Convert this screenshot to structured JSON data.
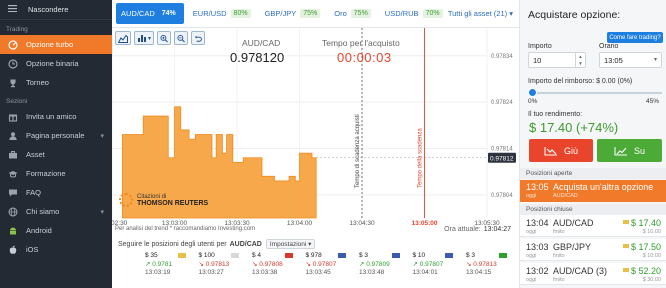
{
  "sidebar": {
    "hide_label": "Nascondere",
    "section_trading": "Trading",
    "section_sections": "Sezioni",
    "items_trading": [
      {
        "label": "Opzione turbo",
        "icon": "turbo-icon"
      },
      {
        "label": "Opzione binaria",
        "icon": "binary-icon"
      },
      {
        "label": "Torneo",
        "icon": "trophy-icon"
      }
    ],
    "items_sections": [
      {
        "label": "Invita un amico",
        "icon": "gift-icon"
      },
      {
        "label": "Pagina personale",
        "icon": "user-icon"
      },
      {
        "label": "Asset",
        "icon": "briefcase-icon"
      },
      {
        "label": "Formazione",
        "icon": "graduation-icon"
      },
      {
        "label": "FAQ",
        "icon": "chat-icon"
      },
      {
        "label": "Chi siamo",
        "icon": "globe-icon"
      },
      {
        "label": "Android",
        "icon": "android-icon"
      },
      {
        "label": "iOS",
        "icon": "apple-icon"
      }
    ]
  },
  "tabs": [
    {
      "pair": "AUD/CAD",
      "pct": "74%"
    },
    {
      "pair": "EUR/USD",
      "pct": "80%"
    },
    {
      "pair": "GBP/JPY",
      "pct": "75%"
    },
    {
      "pair": "Oro",
      "pct": "75%"
    },
    {
      "pair": "USD/RUB",
      "pct": "70%"
    }
  ],
  "all_assets": "Tutti gli asset (21)",
  "chart_header": {
    "pair": "AUD/CAD",
    "price": "0.978120",
    "time_label": "Tempo per l'acquisto",
    "time_value": "00:00:03"
  },
  "chart_data": {
    "type": "area",
    "y_ticks": [
      "0.97834",
      "0.97824",
      "0.97814",
      "0.97804"
    ],
    "y_current": "0.97812",
    "x_ticks": [
      "13:02:30",
      "13:03:00",
      "13:03:30",
      "13:04:00",
      "13:04:30",
      "13:05:00",
      "13:05:30"
    ],
    "x_highlight": "13:05:00",
    "vline_purchase": "Tempo di scadenza acquisti",
    "vline_expiry": "Tempo della scadenza",
    "series": {
      "x": [
        "13:02:35",
        "13:02:40",
        "13:02:45",
        "13:02:50",
        "13:02:53",
        "13:02:57",
        "13:03:00",
        "13:03:03",
        "13:03:07",
        "13:03:10",
        "13:03:14",
        "13:03:18",
        "13:03:20",
        "13:03:23",
        "13:03:25",
        "13:03:28",
        "13:03:30",
        "13:03:33",
        "13:03:35",
        "13:03:38",
        "13:03:42",
        "13:03:45",
        "13:03:48",
        "13:03:52",
        "13:03:55",
        "13:03:58",
        "13:04:00",
        "13:04:03",
        "13:04:06",
        "13:04:08"
      ],
      "y": [
        0.97817,
        0.97817,
        0.97821,
        0.97821,
        0.97821,
        0.97812,
        0.97823,
        0.97818,
        0.97816,
        0.97817,
        0.97817,
        0.97812,
        0.97817,
        0.97813,
        0.97817,
        0.97811,
        0.97811,
        0.97812,
        0.97812,
        0.97812,
        0.97808,
        0.97808,
        0.97807,
        0.97807,
        0.97808,
        0.97807,
        0.97813,
        0.97813,
        0.97812,
        0.97812
      ]
    }
  },
  "thomson": {
    "line1": "Citazioni di",
    "line2": "THOMSON REUTERS"
  },
  "info": {
    "source": "Per analisi del trend * raccomandiamo Investing.com",
    "now_label": "Ora attuale:",
    "now_value": "13:04:27"
  },
  "follow": {
    "text": "Seguire le posizioni degli utenti per",
    "pair": "AUD/CAD",
    "settings": "Impostazioni"
  },
  "trades": [
    {
      "amt": "$ 35",
      "dir": "up",
      "price": "0.9781",
      "time": "13:03:19",
      "flag": "#e5c04a"
    },
    {
      "amt": "$ 100",
      "dir": "dn",
      "price": "0.97813",
      "time": "13:03:27",
      "flag": "#d8d8d8"
    },
    {
      "amt": "$ 4",
      "dir": "dn",
      "price": "0.97808",
      "time": "13:03:38",
      "flag": "#d9382b"
    },
    {
      "amt": "$ 978",
      "dir": "dn",
      "price": "0.97807",
      "time": "13:03:45",
      "flag": "#3b5bb0"
    },
    {
      "amt": "$ 3",
      "dir": "up",
      "price": "0.97809",
      "time": "13:03:48",
      "flag": "#3b5bb0"
    },
    {
      "amt": "$ 10",
      "dir": "up",
      "price": "0.97807",
      "time": "13:04:01",
      "flag": "#3b5bb0"
    },
    {
      "amt": "$ 3",
      "dir": "dn",
      "price": "0.97813",
      "time": "13:04:15",
      "flag": "#2f9e2f"
    }
  ],
  "panel": {
    "title": "Acquistare opzione:",
    "how_to": "Come fare trading?",
    "amount_label": "Importo",
    "amount_value": "10",
    "time_label": "Orario",
    "time_value": "13:05",
    "refund_label": "Importo del rimborso: $ 0.00 (0%)",
    "slider_min": "0%",
    "slider_max": "45%",
    "slider_value": 0,
    "yield_label": "Il tuo rendimento:",
    "yield_value": "$ 17.40 (+74%)",
    "down_label": "Giù",
    "up_label": "Su",
    "open_positions": "Posizioni aperte",
    "open": {
      "time": "13:05",
      "sub": "oggi",
      "action": "Acquista un'altra opzione",
      "pair": "AUD/CAD"
    },
    "closed_positions": "Posizioni chiuse",
    "closed": [
      {
        "time": "13:04",
        "sub": "oggi",
        "pair": "AUD/CAD",
        "end": "finito",
        "amount": "$ 17.40",
        "invest": "$ 10.00"
      },
      {
        "time": "13:03",
        "sub": "oggi",
        "pair": "GBP/JPY",
        "end": "finito",
        "amount": "$ 17.50",
        "invest": "$ 10.00"
      },
      {
        "time": "13:02",
        "sub": "oggi",
        "pair": "AUD/CAD (3)",
        "end": "finito",
        "amount": "$ 52.20",
        "invest": "$ 30.00"
      }
    ]
  },
  "colors": {
    "accent": "#f07a2a",
    "blue": "#1e7fe0",
    "up": "#4caa36",
    "down": "#e8452c",
    "sidebar": "#232a33"
  }
}
